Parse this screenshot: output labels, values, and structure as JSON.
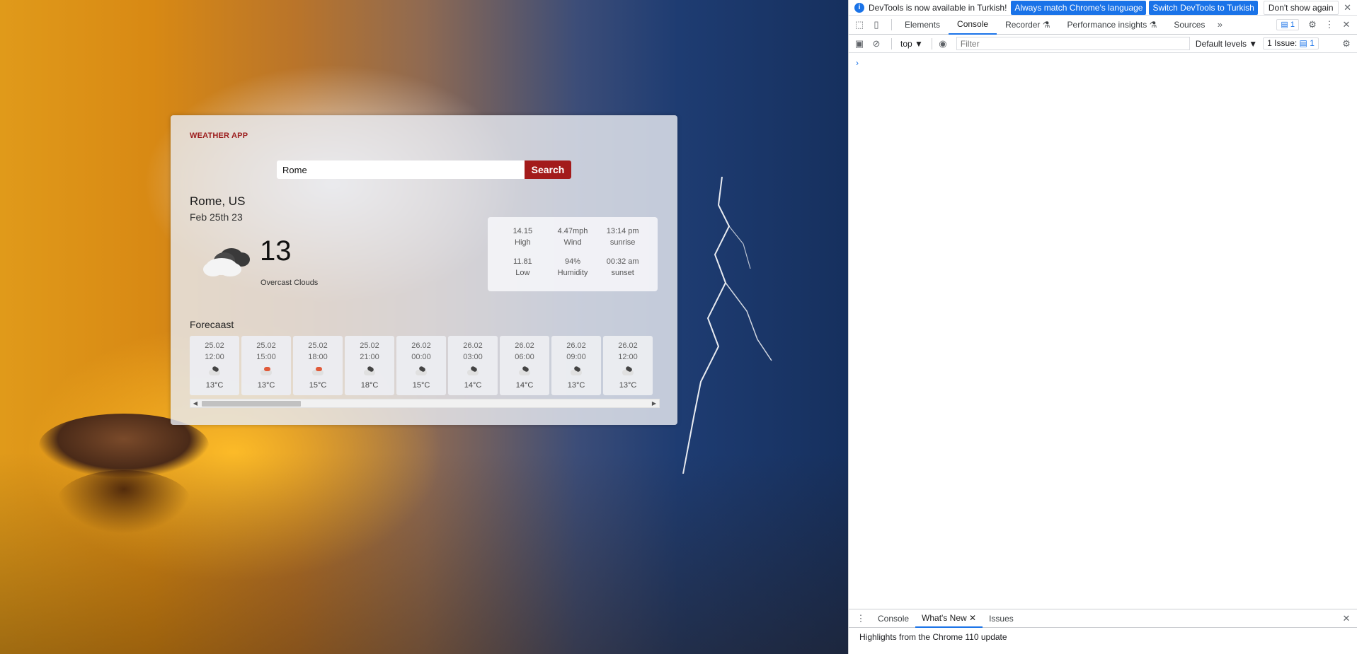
{
  "weather_app": {
    "app_title": "WEATHER APP",
    "search": {
      "value": "Rome",
      "button_label": "Search"
    },
    "location": "Rome, US",
    "date": "Feb 25th 23",
    "current": {
      "temp": "13",
      "description": "Overcast Clouds",
      "icon": "overcast-clouds-icon"
    },
    "details": [
      {
        "value": "14.15",
        "label": "High"
      },
      {
        "value": "4.47mph",
        "label": "Wind"
      },
      {
        "value": "13:14 pm",
        "label": "sunrise"
      },
      {
        "value": "11.81",
        "label": "Low"
      },
      {
        "value": "94%",
        "label": "Humidity"
      },
      {
        "value": "00:32 am",
        "label": "sunset"
      }
    ],
    "forecast_title": "Forecaast",
    "forecast": [
      {
        "date": "25.02",
        "time": "12:00",
        "temp": "13°C",
        "icon": "cloudy-icon"
      },
      {
        "date": "25.02",
        "time": "15:00",
        "temp": "13°C",
        "icon": "rain-icon"
      },
      {
        "date": "25.02",
        "time": "18:00",
        "temp": "15°C",
        "icon": "rain-icon"
      },
      {
        "date": "25.02",
        "time": "21:00",
        "temp": "18°C",
        "icon": "cloudy-icon"
      },
      {
        "date": "26.02",
        "time": "00:00",
        "temp": "15°C",
        "icon": "cloudy-icon"
      },
      {
        "date": "26.02",
        "time": "03:00",
        "temp": "14°C",
        "icon": "cloudy-icon"
      },
      {
        "date": "26.02",
        "time": "06:00",
        "temp": "14°C",
        "icon": "cloudy-icon"
      },
      {
        "date": "26.02",
        "time": "09:00",
        "temp": "13°C",
        "icon": "cloudy-icon"
      },
      {
        "date": "26.02",
        "time": "12:00",
        "temp": "13°C",
        "icon": "cloudy-icon"
      }
    ],
    "accent_color": "#a31b1b"
  },
  "devtools": {
    "infobar": {
      "text": "DevTools is now available in Turkish!",
      "btn_match": "Always match Chrome's language",
      "btn_switch": "Switch DevTools to Turkish",
      "btn_dismiss": "Don't show again"
    },
    "tabs": [
      "Elements",
      "Console",
      "Recorder",
      "Performance insights",
      "Sources"
    ],
    "active_tab": "Console",
    "message_badge": "1",
    "context": "top",
    "filter_placeholder": "Filter",
    "levels": "Default levels",
    "issues_label": "1 Issue:",
    "issues_count": "1",
    "prompt": "›",
    "drawer_tabs": [
      "Console",
      "What's New",
      "Issues"
    ],
    "drawer_text": "Highlights from the Chrome 110 update"
  }
}
